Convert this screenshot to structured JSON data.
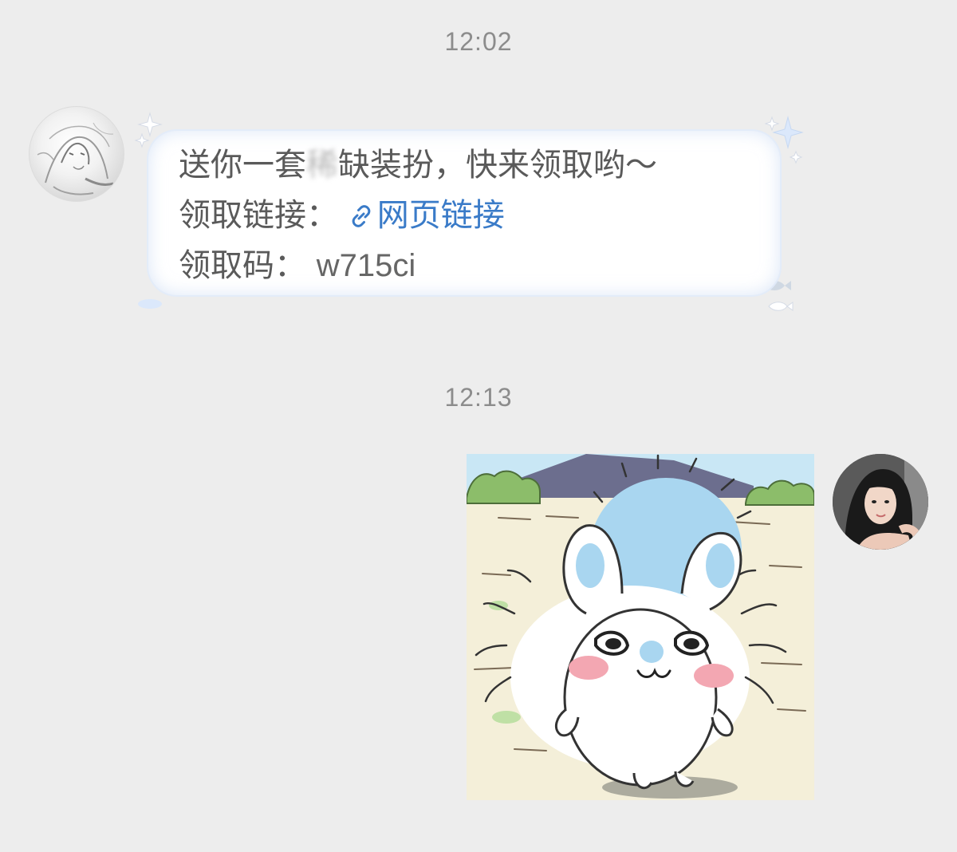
{
  "messages": [
    {
      "timestamp": "12:02",
      "sender": "other",
      "line1_a": "送你一套",
      "line1_blur": "稀",
      "line1_b": "缺装扮，快来领取哟～",
      "line2_label": "领取链接：",
      "line2_link": "网页链接",
      "line3_label": "领取码：",
      "line3_code": "w715ci"
    },
    {
      "timestamp": "12:13",
      "sender": "self",
      "type": "image",
      "image_subject": "fluffy white cartoon bunny"
    }
  ],
  "colors": {
    "background": "#ededed",
    "timestamp": "#8c8c8c",
    "link": "#3a7bc8",
    "bubble": "#ffffff"
  },
  "icons": [
    "sparkle-icon",
    "fish-icon",
    "link-icon"
  ]
}
